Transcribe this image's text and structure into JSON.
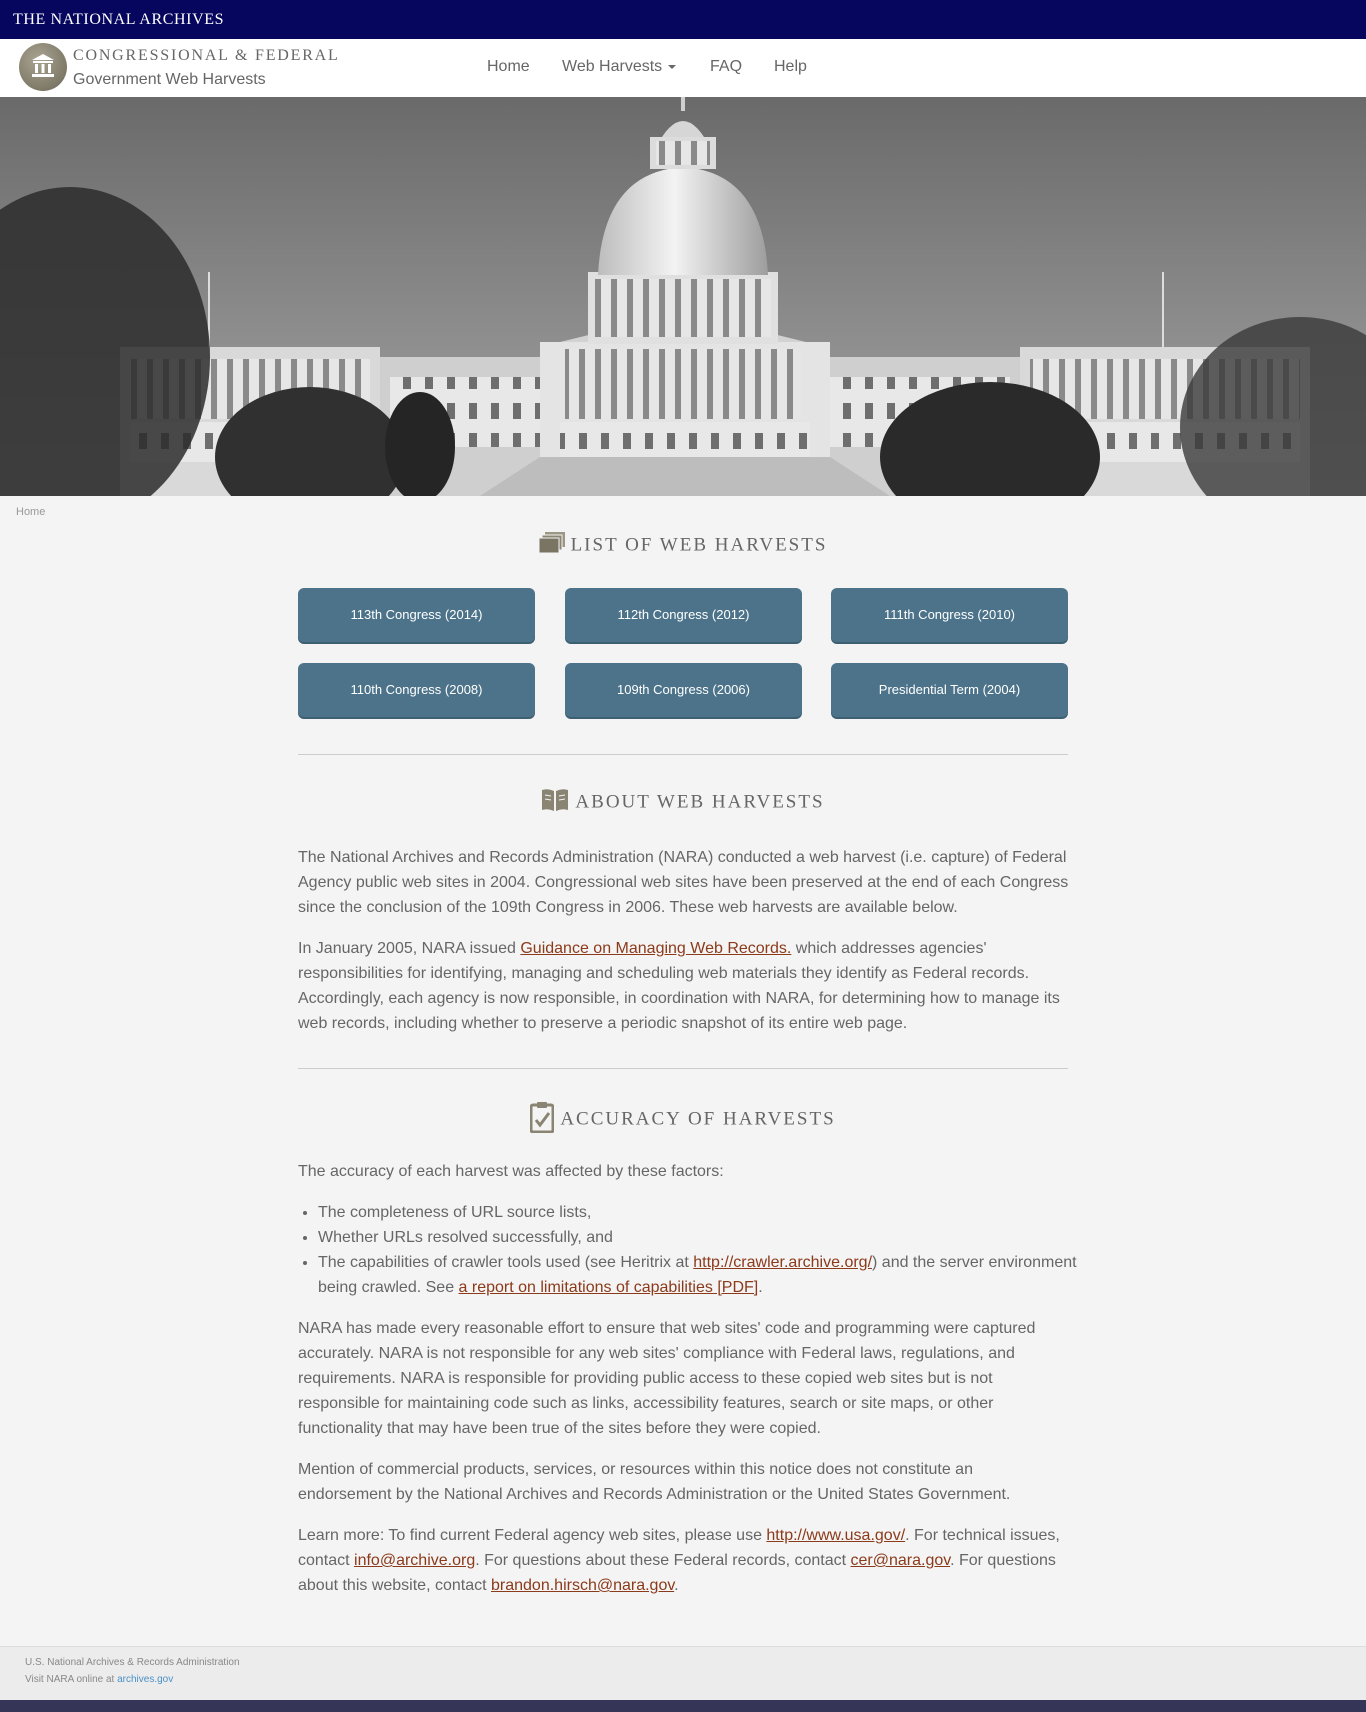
{
  "topbar": {
    "brand": "THE NATIONAL ARCHIVES"
  },
  "navbar": {
    "site_title": "CONGRESSIONAL & FEDERAL",
    "site_subtitle": "Government Web Harvests",
    "items": [
      {
        "label": "Home"
      },
      {
        "label": "Web Harvests"
      },
      {
        "label": "FAQ"
      },
      {
        "label": "Help"
      }
    ]
  },
  "breadcrumb": {
    "home": "Home"
  },
  "list_section": {
    "title": "LIST OF WEB HARVESTS",
    "buttons": [
      {
        "label": "113th Congress (2014)"
      },
      {
        "label": "112th Congress (2012)"
      },
      {
        "label": "111th Congress (2010)"
      },
      {
        "label": "110th Congress (2008)"
      },
      {
        "label": "109th Congress (2006)"
      },
      {
        "label": "Presidential Term (2004)"
      }
    ]
  },
  "about_section": {
    "title": "ABOUT WEB HARVESTS",
    "p1": "The National Archives and Records Administration (NARA) conducted a web harvest (i.e. capture) of Federal Agency public web sites in 2004. Congressional web sites have been preserved at the end of each Congress since the conclusion of the 109th Congress in 2006. These web harvests are available below.",
    "p2_before": "In January 2005, NARA issued ",
    "p2_link": "Guidance on Managing Web Records.",
    "p2_after": " which addresses agencies' responsibilities for identifying, managing and scheduling web materials they identify as Federal records. Accordingly, each agency is now responsible, in coordination with NARA, for determining how to manage its web records, including whether to preserve a periodic snapshot of its entire web page."
  },
  "accuracy_section": {
    "title": "ACCURACY OF HARVESTS",
    "intro": "The accuracy of each harvest was affected by these factors:",
    "bullet1": "The completeness of URL source lists,",
    "bullet2": "Whether URLs resolved successfully, and",
    "bullet3_before": "The capabilities of crawler tools used (see Heritrix at ",
    "bullet3_link1": "http://crawler.archive.org/",
    "bullet3_mid": ") and the server environment being crawled. See ",
    "bullet3_link2": "a report on limitations of capabilities [PDF]",
    "bullet3_after": ".",
    "p2": "NARA has made every reasonable effort to ensure that web sites' code and programming were captured accurately. NARA is not responsible for any web sites' compliance with Federal laws, regulations, and requirements. NARA is responsible for providing public access to these copied web sites but is not responsible for maintaining code such as links, accessibility features, search or site maps, or other functionality that may have been true of the sites before they were copied.",
    "p3": "Mention of commercial products, services, or resources within this notice does not constitute an endorsement by the National Archives and Records Administration or the United States Government.",
    "p4_a": "Learn more: To find current Federal agency web sites, please use ",
    "p4_link1": "http://www.usa.gov/",
    "p4_b": ". For technical issues, contact ",
    "p4_link2": "info@archive.org",
    "p4_c": ". For questions about these Federal records, contact ",
    "p4_link3": "cer@nara.gov",
    "p4_d": ". For questions about this website, contact ",
    "p4_link4": "brandon.hirsch@nara.gov",
    "p4_e": "."
  },
  "footer": {
    "line1": "U.S. National Archives & Records Administration",
    "line2_prefix": "Visit NARA online at ",
    "line2_link": "archives.gov"
  },
  "colors": {
    "topbar": "#06065f",
    "button": "#4c7389",
    "link": "#8b3a1a",
    "bottombar": "#353557"
  },
  "icons": {
    "seal": "building-columns-icon",
    "list": "stacked-pages-icon",
    "about": "open-book-icon",
    "accuracy": "clipboard-check-icon"
  }
}
